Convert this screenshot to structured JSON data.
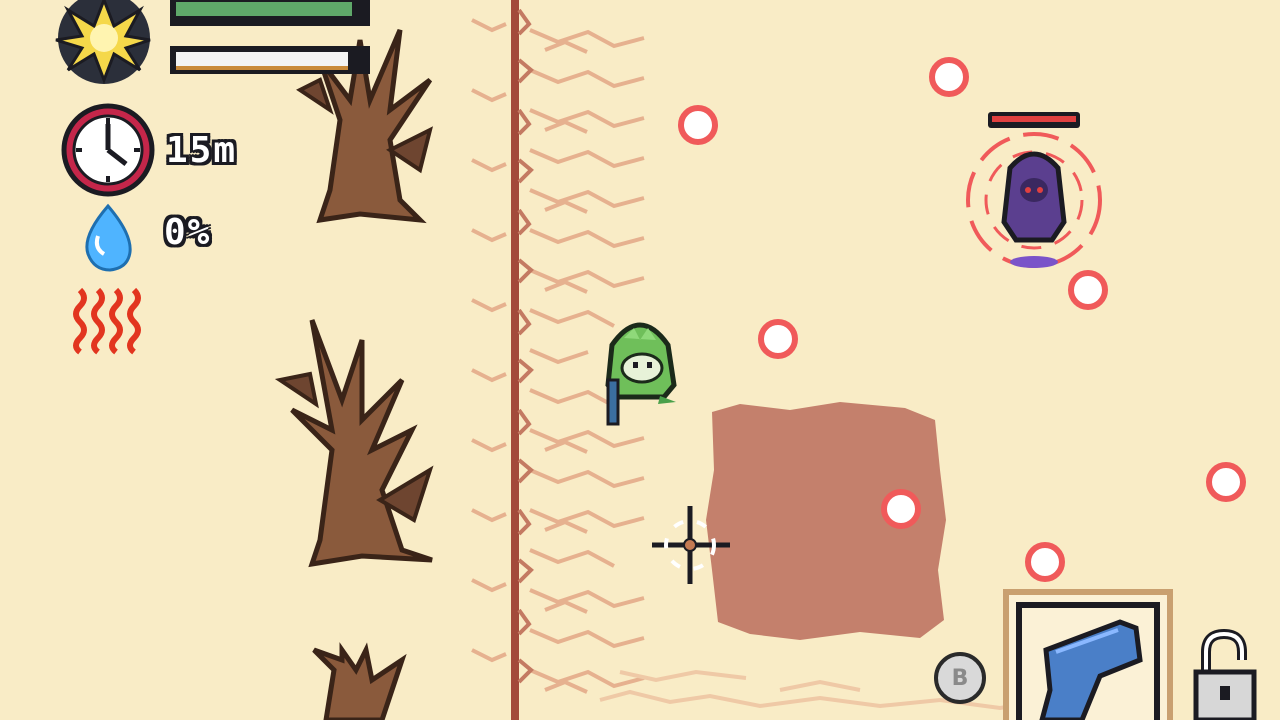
{
  "hud": {
    "time_label": "15m",
    "moisture_label": "0%",
    "health_fraction": 1.0,
    "stamina_fraction": 1.0
  },
  "weapon_slot": {
    "button_label": "B",
    "weapon_icon": "pistol-icon",
    "lock_icon": "unlocked-padlock-icon"
  },
  "enemy": {
    "health_fraction": 1.0
  },
  "colors": {
    "sand": "#f9ecc6",
    "bullet": "#f05a5a",
    "player": "#6fbf5a",
    "enemy": "#5b3f8f",
    "wall": "#a34a3a"
  }
}
